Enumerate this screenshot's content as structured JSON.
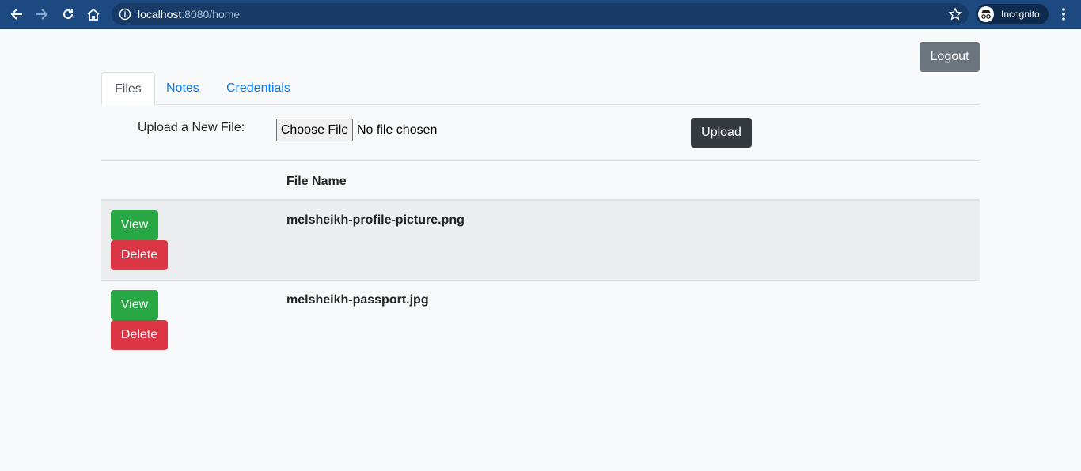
{
  "browser": {
    "url_host": "localhost",
    "url_rest": ":8080/home",
    "incognito_label": "Incognito",
    "icons": [
      "back-arrow-icon",
      "forward-arrow-icon",
      "reload-icon",
      "home-icon",
      "info-icon",
      "star-icon",
      "incognito-icon",
      "menu-dots-icon"
    ]
  },
  "header": {
    "logout_label": "Logout"
  },
  "tabs": [
    {
      "label": "Files",
      "active": true
    },
    {
      "label": "Notes",
      "active": false
    },
    {
      "label": "Credentials",
      "active": false
    }
  ],
  "upload": {
    "label": "Upload a New File:",
    "choose_label": "Choose File",
    "no_file_text": "No file chosen",
    "upload_label": "Upload"
  },
  "table": {
    "header_file_name": "File Name",
    "view_label": "View",
    "delete_label": "Delete",
    "rows": [
      {
        "file_name": "melsheikh-profile-picture.png"
      },
      {
        "file_name": "melsheikh-passport.jpg"
      }
    ]
  },
  "colors": {
    "chrome": "#1c4a80",
    "primary": "#007bff",
    "secondary": "#6c757d",
    "dark": "#343a40",
    "success": "#28a745",
    "danger": "#dc3545"
  }
}
